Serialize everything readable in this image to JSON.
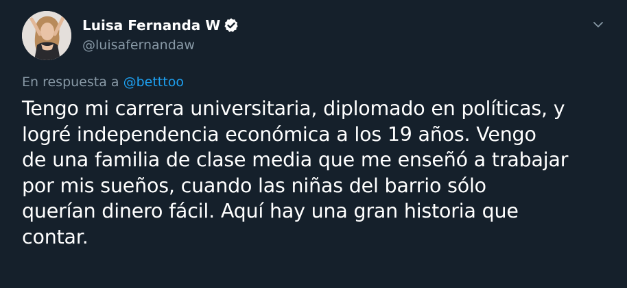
{
  "author": {
    "display_name": "Luisa Fernanda W",
    "handle": "@luisafernandaw",
    "verified_icon": "verified-badge-icon"
  },
  "reply": {
    "prefix": "En respuesta a",
    "mention": "@betttoo"
  },
  "tweet": {
    "lines": [
      "Tengo mi carrera universitaria, diplomado en políticas, y",
      "logré independencia económica a los 19 años. Vengo",
      "de una familia de clase media que me enseñó a trabajar",
      "por mis sueños, cuando las niñas del barrio sólo",
      "querían dinero fácil. Aquí hay una gran historia que",
      "contar."
    ]
  },
  "menu": {
    "icon": "chevron-down-icon"
  },
  "colors": {
    "background": "#15202b",
    "primary_text": "#ffffff",
    "secondary_text": "#8899a6",
    "accent": "#1da1f2"
  }
}
